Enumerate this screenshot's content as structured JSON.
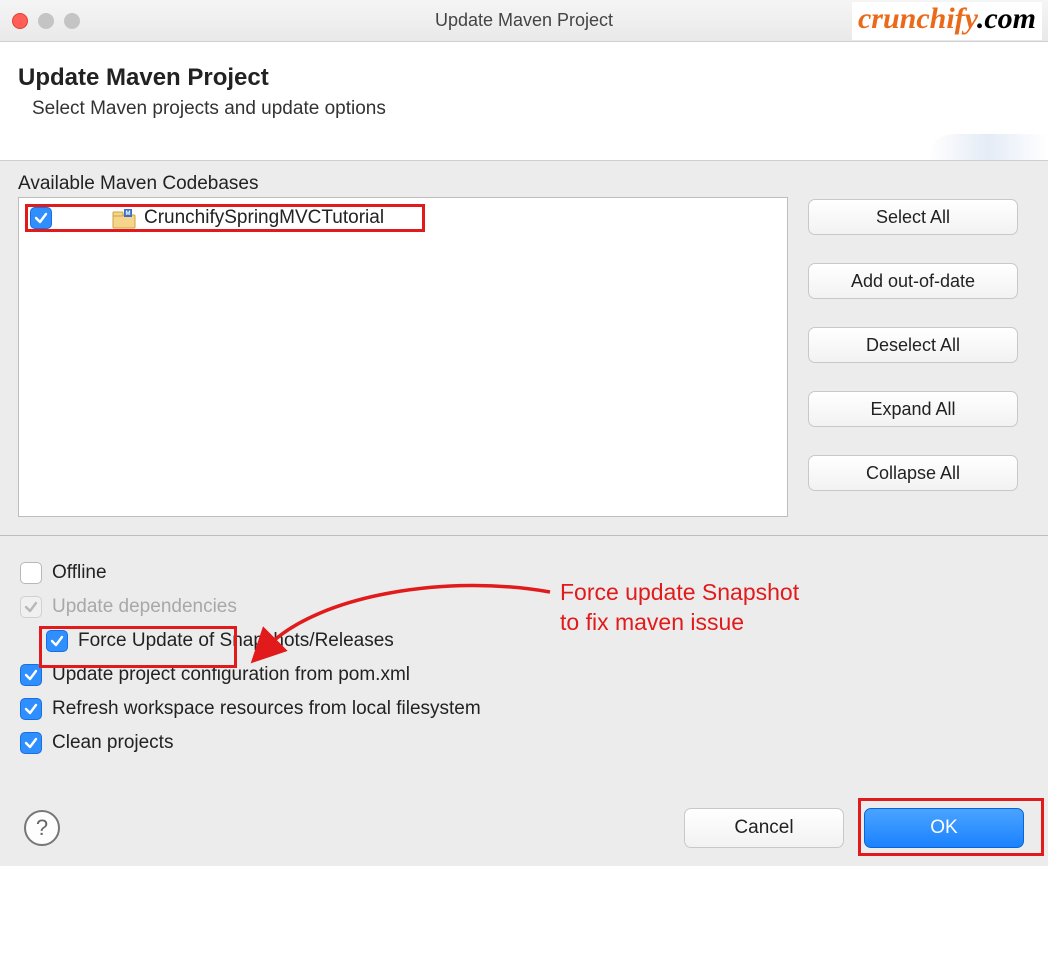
{
  "titlebar": {
    "title": "Update Maven Project"
  },
  "brand": {
    "left": "crunchify",
    "right": ".com"
  },
  "header": {
    "title": "Update Maven Project",
    "subtitle": "Select Maven projects and update options"
  },
  "codebases": {
    "label": "Available Maven Codebases",
    "items": [
      {
        "label": "CrunchifySpringMVCTutorial",
        "checked": true
      }
    ]
  },
  "buttons": {
    "select_all": "Select All",
    "add_out_of_date": "Add out-of-date",
    "deselect_all": "Deselect All",
    "expand_all": "Expand All",
    "collapse_all": "Collapse All",
    "cancel": "Cancel",
    "ok": "OK"
  },
  "options": {
    "offline": {
      "label": "Offline",
      "checked": false
    },
    "update_dependencies": {
      "label": "Update dependencies",
      "checked": true,
      "disabled": true
    },
    "force_update": {
      "label": "Force Update of Snapshots/Releases",
      "checked": true
    },
    "update_project_cfg": {
      "label": "Update project configuration from pom.xml",
      "checked": true
    },
    "refresh_workspace": {
      "label": "Refresh workspace resources from local filesystem",
      "checked": true
    },
    "clean_projects": {
      "label": "Clean projects",
      "checked": true
    }
  },
  "annotation": {
    "line1": "Force update Snapshot",
    "line2": "to fix maven issue"
  }
}
